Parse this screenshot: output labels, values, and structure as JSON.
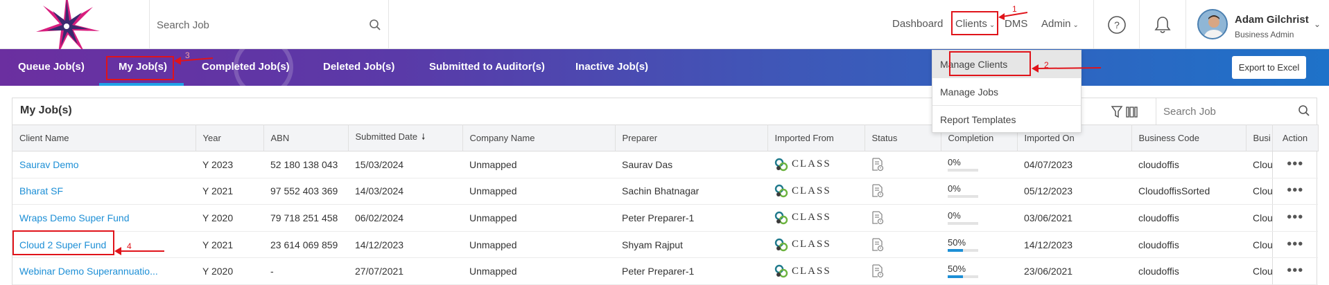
{
  "header": {
    "search_placeholder": "Search Job",
    "nav": {
      "dashboard": "Dashboard",
      "clients": "Clients",
      "dms": "DMS",
      "admin": "Admin"
    },
    "user": {
      "name": "Adam Gilchrist",
      "role": "Business Admin"
    }
  },
  "tabs": [
    "Queue Job(s)",
    "My Job(s)",
    "Completed Job(s)",
    "Deleted Job(s)",
    "Submitted to Auditor(s)",
    "Inactive Job(s)"
  ],
  "active_tab": "My Job(s)",
  "export_label": "Export to Excel",
  "clients_menu": [
    "Manage Clients",
    "Manage Jobs",
    "Report Templates"
  ],
  "card": {
    "title": "My Job(s)",
    "search_placeholder": "Search Job"
  },
  "table": {
    "columns": [
      "Client Name",
      "Year",
      "ABN",
      "Submitted Date",
      "Company Name",
      "Preparer",
      "Imported From",
      "Status",
      "Completion",
      "Imported On",
      "Business Code",
      "Busi",
      "Action"
    ],
    "rows": [
      {
        "client": "Saurav Demo",
        "year": "Y 2023",
        "abn": "52 180 138 043",
        "submitted": "15/03/2024",
        "company": "Unmapped",
        "preparer": "Saurav Das",
        "imported_from": "CLASS",
        "completion": "0%",
        "completion_value": 0,
        "imported_on": "04/07/2023",
        "business_code": "cloudoffis",
        "busi": "Clou"
      },
      {
        "client": "Bharat SF",
        "year": "Y 2021",
        "abn": "97 552 403 369",
        "submitted": "14/03/2024",
        "company": "Unmapped",
        "preparer": "Sachin Bhatnagar",
        "imported_from": "CLASS",
        "completion": "0%",
        "completion_value": 0,
        "imported_on": "05/12/2023",
        "business_code": "CloudoffisSorted",
        "busi": "Clou"
      },
      {
        "client": "Wraps Demo Super Fund",
        "year": "Y 2020",
        "abn": "79 718 251 458",
        "submitted": "06/02/2024",
        "company": "Unmapped",
        "preparer": "Peter Preparer-1",
        "imported_from": "CLASS",
        "completion": "0%",
        "completion_value": 0,
        "imported_on": "03/06/2021",
        "business_code": "cloudoffis",
        "busi": "Clou"
      },
      {
        "client": "Cloud 2 Super Fund",
        "year": "Y 2021",
        "abn": "23 614 069 859",
        "submitted": "14/12/2023",
        "company": "Unmapped",
        "preparer": "Shyam Rajput",
        "imported_from": "CLASS",
        "completion": "50%",
        "completion_value": 50,
        "imported_on": "14/12/2023",
        "business_code": "cloudoffis",
        "busi": "Clou"
      },
      {
        "client": "Webinar Demo Superannuatio...",
        "year": "Y 2020",
        "abn": "-",
        "submitted": "27/07/2021",
        "company": "Unmapped",
        "preparer": "Peter Preparer-1",
        "imported_from": "CLASS",
        "completion": "50%",
        "completion_value": 50,
        "imported_on": "23/06/2021",
        "business_code": "cloudoffis",
        "busi": "Clou"
      }
    ]
  },
  "annotations": [
    "1",
    "2",
    "3",
    "4"
  ],
  "colors": {
    "accent": "#1d8fd6",
    "annotation": "#e0131a",
    "band_start": "#6b2fa0",
    "band_end": "#1e72c9"
  }
}
